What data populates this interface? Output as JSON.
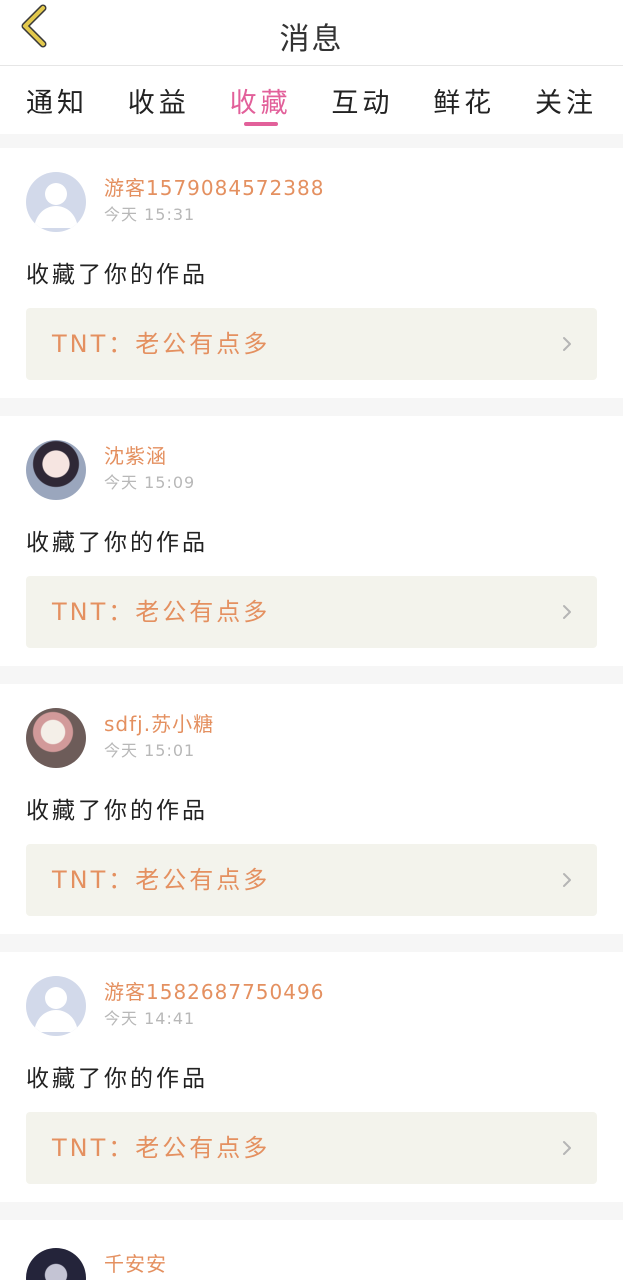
{
  "header": {
    "title": "消息"
  },
  "tabs": [
    {
      "label": "通知",
      "active": false
    },
    {
      "label": "收益",
      "active": false
    },
    {
      "label": "收藏",
      "active": true
    },
    {
      "label": "互动",
      "active": false
    },
    {
      "label": "鲜花",
      "active": false
    },
    {
      "label": "关注",
      "active": false
    }
  ],
  "messages": [
    {
      "username": "游客1579084572388",
      "time": "今天 15:31",
      "action": "收藏了你的作品",
      "work_title": "TNT：老公有点多",
      "avatar": "default-avatar"
    },
    {
      "username": "沈紫涵",
      "time": "今天 15:09",
      "action": "收藏了你的作品",
      "work_title": "TNT：老公有点多",
      "avatar": "user-photo-avatar"
    },
    {
      "username": "sdfj.苏小糖",
      "time": "今天 15:01",
      "action": "收藏了你的作品",
      "work_title": "TNT：老公有点多",
      "avatar": "user-photo-avatar"
    },
    {
      "username": "游客1582687750496",
      "time": "今天 14:41",
      "action": "收藏了你的作品",
      "work_title": "TNT：老公有点多",
      "avatar": "default-avatar"
    },
    {
      "username": "千安安",
      "avatar": "user-photo-avatar"
    }
  ],
  "colors": {
    "active_tab": "#e2609a",
    "accent_orange": "#e49060",
    "link_bg": "#f3f3ec",
    "back_icon": "#e3c94d",
    "muted_text": "#b8b8b8",
    "page_bg": "#f6f6f6"
  },
  "icons": {
    "back": "chevron-left-icon",
    "link_arrow": "chevron-right-icon"
  }
}
